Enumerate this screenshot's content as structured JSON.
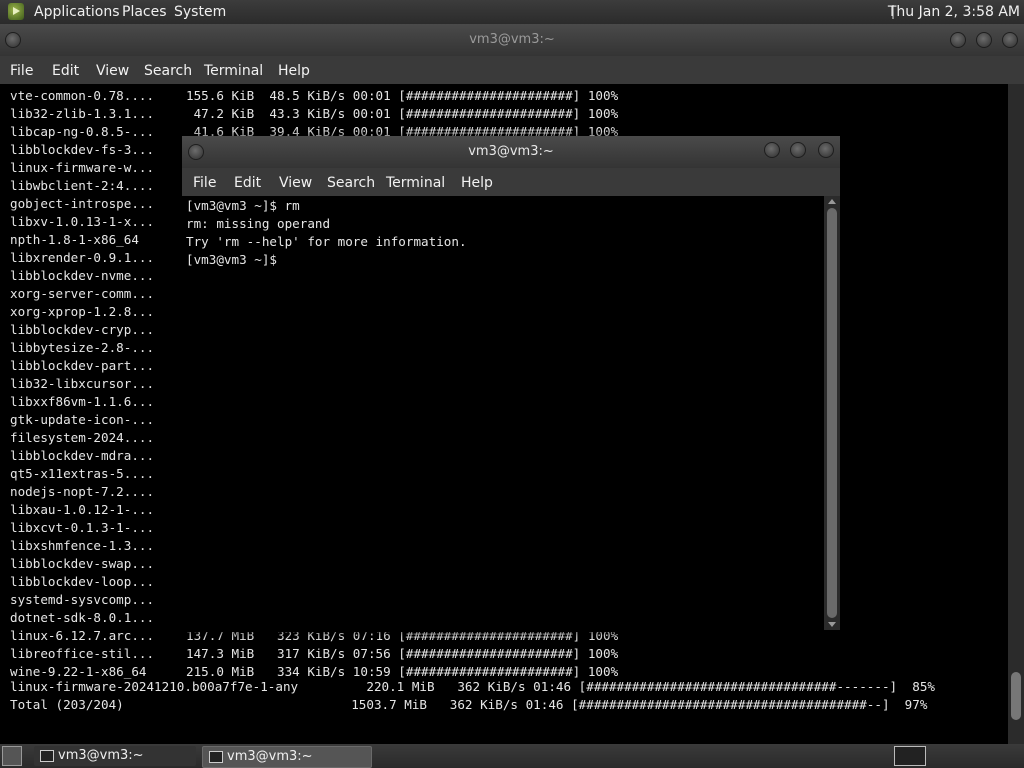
{
  "top_panel": {
    "menus": [
      "Applications",
      "Places",
      "System"
    ],
    "clock": "Thu Jan  2,  3:58 AM"
  },
  "back_window": {
    "title": "vm3@vm3:~",
    "menu": [
      "File",
      "Edit",
      "View",
      "Search",
      "Terminal",
      "Help"
    ],
    "lines_top": [
      {
        "name": "vte-common-0.78....",
        "stats": "155.6 KiB  48.5 KiB/s 00:01 [######################] 100%"
      },
      {
        "name": "lib32-zlib-1.3.1...",
        "stats": " 47.2 KiB  43.3 KiB/s 00:01 [######################] 100%"
      },
      {
        "name": "libcap-ng-0.8.5-...",
        "stats": " 41.6 KiB  39.4 KiB/s 00:01 [######################] 100%"
      },
      {
        "name": "libblockdev-fs-3...",
        "stats": ""
      },
      {
        "name": "linux-firmware-w...",
        "stats": ""
      },
      {
        "name": "libwbclient-2:4....",
        "stats": ""
      },
      {
        "name": "gobject-introspe...",
        "stats": ""
      },
      {
        "name": "libxv-1.0.13-1-x...",
        "stats": ""
      },
      {
        "name": "npth-1.8-1-x86_64",
        "stats": ""
      },
      {
        "name": "libxrender-0.9.1...",
        "stats": ""
      },
      {
        "name": "libblockdev-nvme...",
        "stats": ""
      },
      {
        "name": "xorg-server-comm...",
        "stats": ""
      },
      {
        "name": "xorg-xprop-1.2.8...",
        "stats": ""
      },
      {
        "name": "libblockdev-cryp...",
        "stats": ""
      },
      {
        "name": "libbytesize-2.8-...",
        "stats": ""
      },
      {
        "name": "libblockdev-part...",
        "stats": ""
      },
      {
        "name": "lib32-libxcursor...",
        "stats": ""
      },
      {
        "name": "libxxf86vm-1.1.6...",
        "stats": ""
      },
      {
        "name": "gtk-update-icon-...",
        "stats": ""
      },
      {
        "name": "filesystem-2024....",
        "stats": ""
      },
      {
        "name": "libblockdev-mdra...",
        "stats": ""
      },
      {
        "name": "qt5-x11extras-5....",
        "stats": ""
      },
      {
        "name": "nodejs-nopt-7.2....",
        "stats": ""
      },
      {
        "name": "libxau-1.0.12-1-...",
        "stats": ""
      },
      {
        "name": "libxcvt-0.1.3-1-...",
        "stats": ""
      },
      {
        "name": "libxshmfence-1.3...",
        "stats": ""
      },
      {
        "name": "libblockdev-swap...",
        "stats": ""
      },
      {
        "name": "libblockdev-loop...",
        "stats": ""
      },
      {
        "name": "systemd-sysvcomp...",
        "stats": ""
      },
      {
        "name": "dotnet-sdk-8.0.1...",
        "stats": ""
      },
      {
        "name": "linux-6.12.7.arc...",
        "stats": "137.7 MiB   323 KiB/s 07:16 [######################] 100%"
      },
      {
        "name": "libreoffice-stil...",
        "stats": "147.3 MiB   317 KiB/s 07:56 [######################] 100%"
      },
      {
        "name": "wine-9.22-1-x86_64",
        "stats": "215.0 MiB   334 KiB/s 10:59 [######################] 100%"
      }
    ],
    "line_firmware": "linux-firmware-20241210.b00a7f7e-1-any         220.1 MiB   362 KiB/s 01:46 [#################################-------]  85%",
    "line_total": "Total (203/204)                              1503.7 MiB   362 KiB/s 01:46 [######################################--]  97%"
  },
  "front_window": {
    "title": "vm3@vm3:~",
    "menu": [
      "File",
      "Edit",
      "View",
      "Search",
      "Terminal",
      "Help"
    ],
    "lines": [
      "[vm3@vm3 ~]$ rm",
      "rm: missing operand",
      "Try 'rm --help' for more information.",
      "[vm3@vm3 ~]$"
    ]
  },
  "bottom_panel": {
    "tasks": [
      "vm3@vm3:~",
      "vm3@vm3:~"
    ]
  }
}
